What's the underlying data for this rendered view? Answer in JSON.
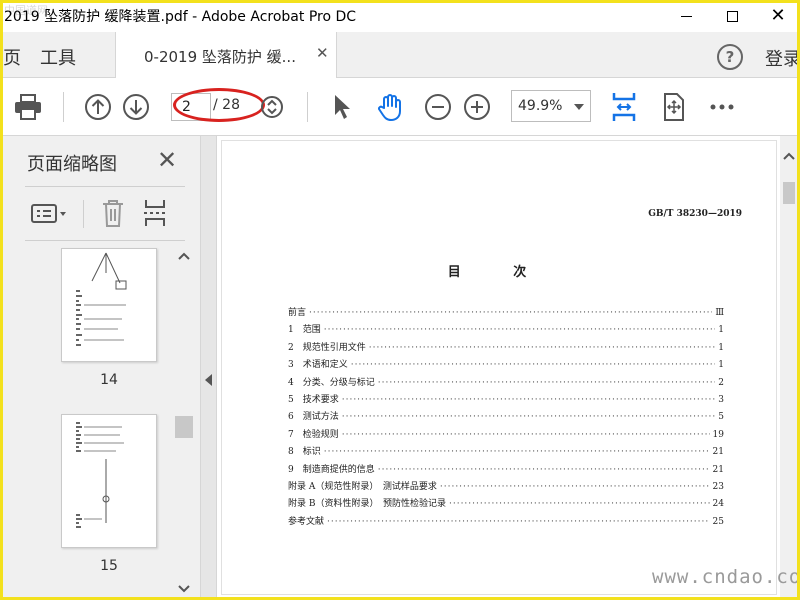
{
  "window": {
    "title": "2019 坠落防护 缓降装置.pdf - Adobe Acrobat Pro DC"
  },
  "tabs": {
    "home_label": "页",
    "tools_label": "工具",
    "document_tab_label": "0-2019 坠落防护 缓...",
    "help_label": "?",
    "signin_label": "登录"
  },
  "toolbar": {
    "current_page": "2",
    "total_pages": "/ 28",
    "zoom": "49.9%",
    "icons": [
      "print-icon",
      "previous-page-icon",
      "next-page-icon",
      "zoom-stepper-icon",
      "select-pointer-icon",
      "hand-tool-icon",
      "zoom-out-icon",
      "zoom-in-icon",
      "fit-width-icon",
      "full-screen-icon",
      "more-icon"
    ],
    "annotation_color": "#d8221f"
  },
  "sidebar": {
    "title": "页面缩略图",
    "thumbnails": [
      {
        "page": "14"
      },
      {
        "page": "15"
      }
    ]
  },
  "document": {
    "standard_code": "GB/T 38230—2019",
    "toc_heading": "目 次",
    "toc": [
      {
        "label": "前言",
        "page": "Ⅲ"
      },
      {
        "label": "1　范围",
        "page": "1"
      },
      {
        "label": "2　规范性引用文件",
        "page": "1"
      },
      {
        "label": "3　术语和定义",
        "page": "1"
      },
      {
        "label": "4　分类、分级与标记",
        "page": "2"
      },
      {
        "label": "5　技术要求",
        "page": "3"
      },
      {
        "label": "6　测试方法",
        "page": "5"
      },
      {
        "label": "7　检验规则",
        "page": "19"
      },
      {
        "label": "8　标识",
        "page": "21"
      },
      {
        "label": "9　制造商提供的信息",
        "page": "21"
      },
      {
        "label": "附录 A（规范性附录）　测试样品要求",
        "page": "23"
      },
      {
        "label": "附录 B（资料性附录）　预防性检验记录",
        "page": "24"
      },
      {
        "label": "参考文献",
        "page": "25"
      }
    ]
  },
  "watermark": {
    "text": "www.cndao.com",
    "corner_text": "中国道网"
  },
  "colors": {
    "accent_blue": "#1473e6",
    "frame_yellow": "#f3e11d"
  }
}
